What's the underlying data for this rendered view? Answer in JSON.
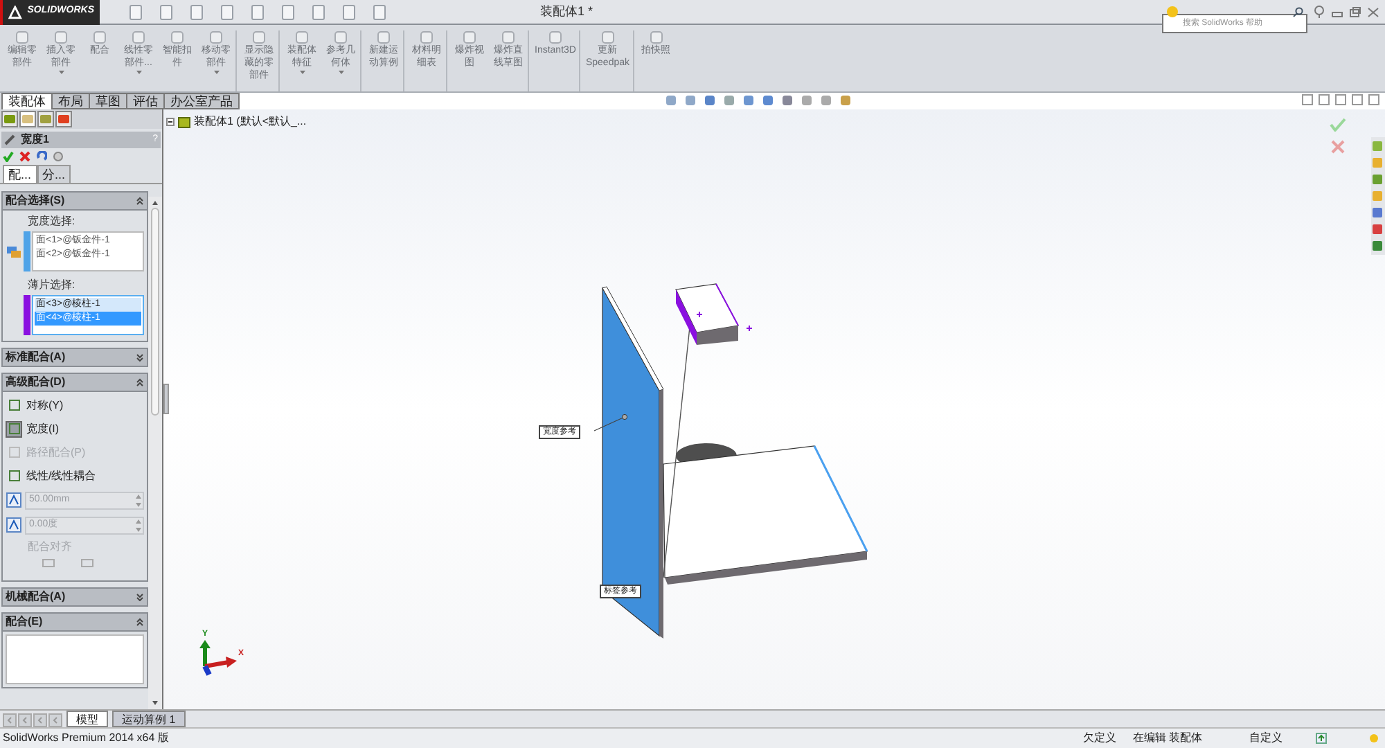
{
  "window": {
    "app": "SOLIDWORKS",
    "title": "装配体1 *",
    "search_placeholder": "搜索 SolidWorks 帮助"
  },
  "ribbon": [
    [
      {
        "lines": [
          "编辑零",
          "部件"
        ],
        "dropdown": false
      },
      {
        "lines": [
          "插入零",
          "部件"
        ],
        "dropdown": true
      },
      {
        "lines": [
          "配合"
        ],
        "dropdown": false
      },
      {
        "lines": [
          "线性零",
          "部件..."
        ],
        "dropdown": true
      },
      {
        "lines": [
          "智能扣",
          "件"
        ],
        "dropdown": false
      },
      {
        "lines": [
          "移动零",
          "部件"
        ],
        "dropdown": true
      }
    ],
    [
      {
        "lines": [
          "显示隐",
          "藏的零",
          "部件"
        ],
        "dropdown": false
      }
    ],
    [
      {
        "lines": [
          "装配体",
          "特征"
        ],
        "dropdown": true
      },
      {
        "lines": [
          "参考几",
          "何体"
        ],
        "dropdown": true
      }
    ],
    [
      {
        "lines": [
          "新建运",
          "动算例"
        ],
        "dropdown": false
      }
    ],
    [
      {
        "lines": [
          "材料明",
          "细表"
        ],
        "dropdown": false
      }
    ],
    [
      {
        "lines": [
          "爆炸视",
          "图"
        ],
        "dropdown": false
      },
      {
        "lines": [
          "爆炸直",
          "线草图"
        ],
        "dropdown": false
      }
    ],
    [
      {
        "lines": [
          "Instant3D"
        ],
        "dropdown": false
      }
    ],
    [
      {
        "lines": [
          "更新",
          "Speedpak"
        ],
        "dropdown": false
      }
    ],
    [
      {
        "lines": [
          "拍快照"
        ],
        "dropdown": false
      }
    ]
  ],
  "command_tabs": [
    {
      "label": "装配体",
      "selected": true
    },
    {
      "label": "布局",
      "selected": false
    },
    {
      "label": "草图",
      "selected": false
    },
    {
      "label": "评估",
      "selected": false
    },
    {
      "label": "办公室产品",
      "selected": false
    }
  ],
  "property_manager": {
    "title": "宽度1",
    "help": "?",
    "subtabs": [
      {
        "label": "配...",
        "selected": true
      },
      {
        "label": "分...",
        "selected": false
      }
    ],
    "sections": [
      {
        "kind": "selections",
        "title": "配合选择(S)",
        "expanded": true,
        "groups": [
          {
            "label": "宽度选择:",
            "color": "#4fa3e8",
            "items": [
              {
                "text": "面<1>@钣金件-1",
                "selected": false
              },
              {
                "text": "面<2>@钣金件-1",
                "selected": false
              }
            ]
          },
          {
            "label": "薄片选择:",
            "color": "#8a10e0",
            "items": [
              {
                "text": "面<3>@棱柱-1",
                "selected": false
              },
              {
                "text": "面<4>@棱柱-1",
                "selected": true
              }
            ]
          }
        ]
      },
      {
        "kind": "collapsed",
        "title": "标准配合(A)",
        "expanded": false
      },
      {
        "kind": "advanced",
        "title": "高级配合(D)",
        "expanded": true,
        "options": [
          {
            "text": "对称(Y)",
            "selected": false,
            "disabled": false
          },
          {
            "text": "宽度(I)",
            "selected": true,
            "disabled": false
          },
          {
            "text": "路径配合(P)",
            "selected": false,
            "disabled": true
          },
          {
            "text": "线性/线性耦合",
            "selected": false,
            "disabled": false
          }
        ],
        "fields": [
          {
            "value": "50.00mm",
            "disabled": true
          },
          {
            "value": "0.00度",
            "disabled": true
          }
        ],
        "alignment_label": "配合对齐"
      },
      {
        "kind": "collapsed",
        "title": "机械配合(A)",
        "expanded": false
      },
      {
        "kind": "list",
        "title": "配合(E)",
        "expanded": true
      }
    ]
  },
  "tree": {
    "root": "装配体1 (默认<默认_..."
  },
  "manager_tabs": [
    {
      "selected": false
    },
    {
      "selected": true
    },
    {
      "selected": false
    },
    {
      "selected": false
    }
  ],
  "viewport": {
    "callouts": [
      {
        "text": "宽度参考"
      },
      {
        "text": "标签参考"
      }
    ],
    "axes": [
      "X",
      "Y"
    ]
  },
  "bottom_tabs": [
    {
      "label": "模型",
      "selected": true
    },
    {
      "label": "运动算例 1",
      "selected": false
    }
  ],
  "status_bar": {
    "product": "SolidWorks Premium 2014 x64 版",
    "state": "欠定义",
    "mode": "在编辑 装配体",
    "units": "自定义"
  }
}
